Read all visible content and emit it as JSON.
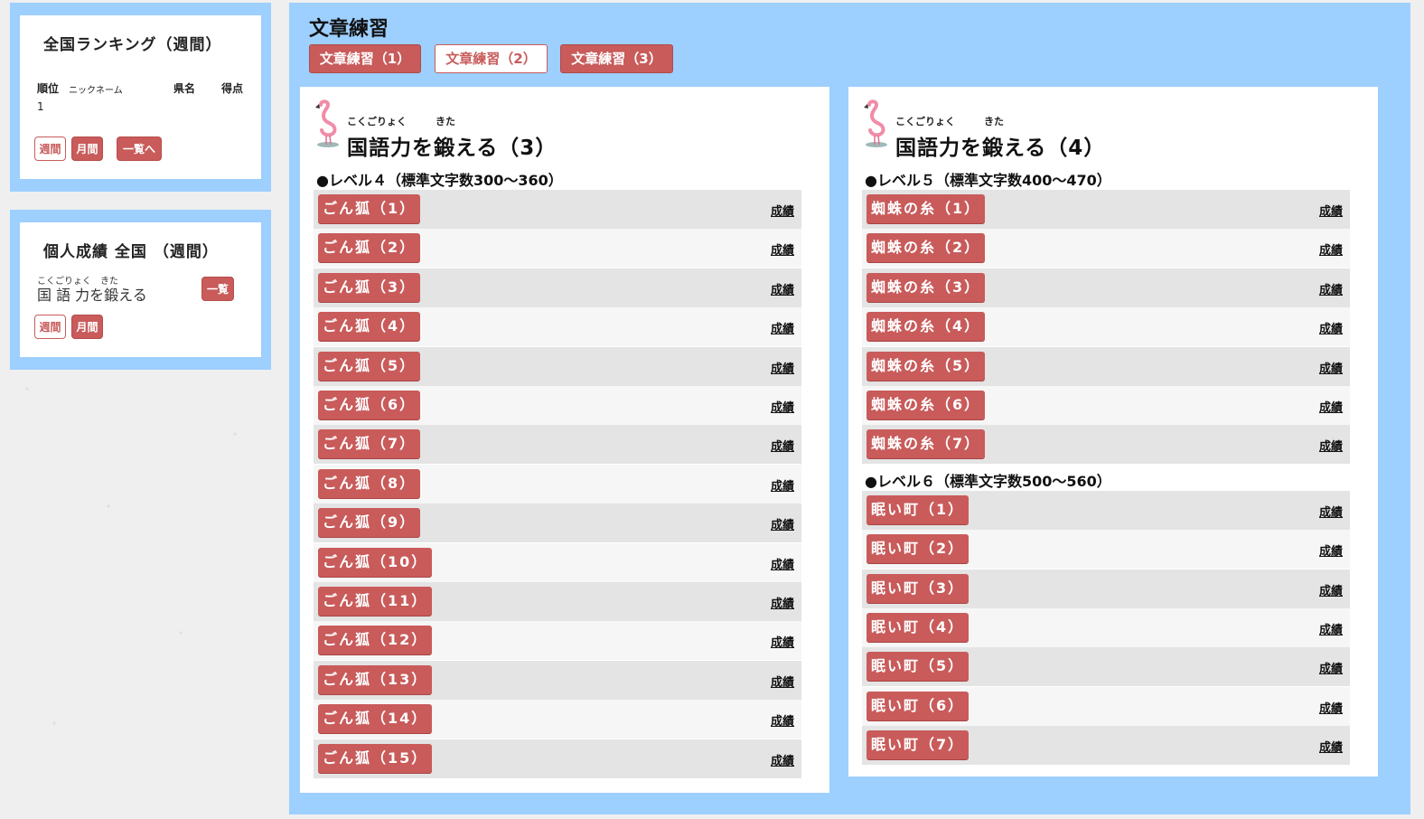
{
  "sidebar": {
    "ranking": {
      "title": "全国ランキング（週間）",
      "headers": {
        "rank": "順位",
        "nickname": "ニックネーム",
        "prefecture": "県名",
        "score": "得点"
      },
      "rows": [
        {
          "rank": "1"
        }
      ],
      "buttons": {
        "weekly": "週間",
        "monthly": "月間",
        "list": "一覧へ"
      }
    },
    "personal": {
      "title": "個人成績 全国 （週間）",
      "ruby": "こくごりょく　きた",
      "course": "国 語 力を鍛える",
      "buttons": {
        "list": "一覧",
        "weekly": "週間",
        "monthly": "月間"
      }
    }
  },
  "main": {
    "title": "文章練習",
    "tabs": [
      "文章練習（1）",
      "文章練習（2）",
      "文章練習（3）"
    ],
    "active_tab": 1,
    "panels": [
      {
        "ruby_a": "こくごりょく",
        "ruby_b": "きた",
        "heading": "国語力を鍛える（3）",
        "levels": [
          {
            "label": "●レベル４（標準文字数300～360）",
            "items": [
              "ごん狐（1）",
              "ごん狐（2）",
              "ごん狐（3）",
              "ごん狐（4）",
              "ごん狐（5）",
              "ごん狐（6）",
              "ごん狐（7）",
              "ごん狐（8）",
              "ごん狐（9）",
              "ごん狐（10）",
              "ごん狐（11）",
              "ごん狐（12）",
              "ごん狐（13）",
              "ごん狐（14）",
              "ごん狐（15）"
            ]
          }
        ]
      },
      {
        "ruby_a": "こくごりょく",
        "ruby_b": "きた",
        "heading": "国語力を鍛える（4）",
        "levels": [
          {
            "label": "●レベル５（標準文字数400～470）",
            "items": [
              "蜘蛛の糸（1）",
              "蜘蛛の糸（2）",
              "蜘蛛の糸（3）",
              "蜘蛛の糸（4）",
              "蜘蛛の糸（5）",
              "蜘蛛の糸（6）",
              "蜘蛛の糸（7）"
            ]
          },
          {
            "label": "●レベル６（標準文字数500～560）",
            "items": [
              "眠い町（1）",
              "眠い町（2）",
              "眠い町（3）",
              "眠い町（4）",
              "眠い町（5）",
              "眠い町（6）",
              "眠い町（7）"
            ]
          }
        ]
      }
    ],
    "result_label": "成績"
  },
  "colors": {
    "accent": "#c95b5b",
    "frame": "#9dcfff"
  }
}
